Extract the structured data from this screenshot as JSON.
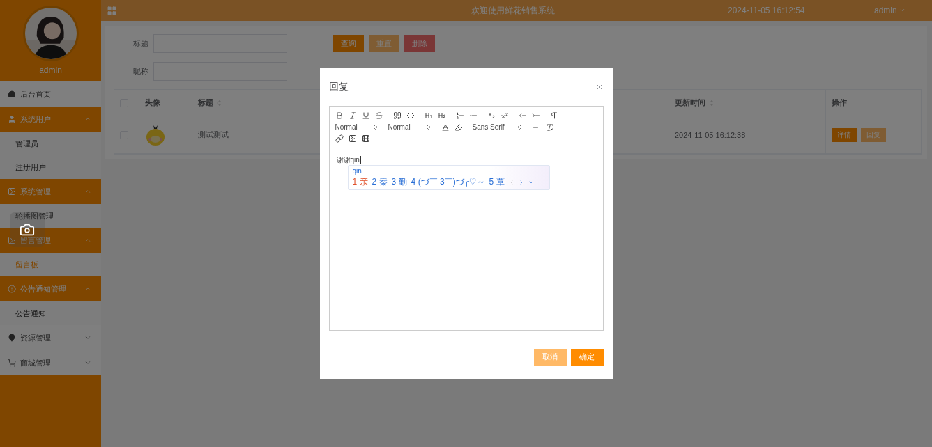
{
  "sidebar": {
    "user": "admin",
    "menu": [
      {
        "label": "后台首页",
        "kind": "link"
      },
      {
        "label": "系统用户",
        "kind": "group",
        "expanded": true,
        "children": [
          {
            "label": "管理员",
            "selected": false
          },
          {
            "label": "注册用户",
            "selected": false
          }
        ]
      },
      {
        "label": "系统管理",
        "kind": "group",
        "expanded": true,
        "children": [
          {
            "label": "轮播图管理",
            "selected": false
          }
        ]
      },
      {
        "label": "留言管理",
        "kind": "group",
        "expanded": true,
        "children": [
          {
            "label": "留言板",
            "selected": true
          }
        ]
      },
      {
        "label": "公告通知管理",
        "kind": "group",
        "expanded": true,
        "children": [
          {
            "label": "公告通知",
            "selected": false
          }
        ]
      },
      {
        "label": "资源管理",
        "kind": "group",
        "expanded": false
      },
      {
        "label": "商城管理",
        "kind": "group",
        "expanded": false
      }
    ]
  },
  "header": {
    "title": "欢迎使用鲜花销售系统",
    "datetime": "2024-11-05 16:12:54",
    "user": "admin"
  },
  "search": {
    "fields": [
      {
        "label": "标题"
      },
      {
        "label": "昵称"
      }
    ],
    "buttons": [
      {
        "label": "查询",
        "kind": "primary"
      },
      {
        "label": "重置",
        "kind": "secondary"
      },
      {
        "label": "删除",
        "kind": "danger"
      }
    ]
  },
  "table": {
    "all_checked": false,
    "columns": [
      {
        "label": "头像",
        "sortable": false
      },
      {
        "label": "标题",
        "sortable": true
      },
      {
        "label": "更新时间",
        "sortable": true
      },
      {
        "label": "操作",
        "sortable": false
      }
    ],
    "rows": [
      {
        "checked": false,
        "title": "测试测试",
        "updated": "2024-11-05 16:12:38",
        "actions": [
          {
            "label": "详情",
            "kind": "primary"
          },
          {
            "label": "回复",
            "kind": "secondary"
          }
        ]
      }
    ]
  },
  "modal": {
    "title": "回复",
    "toolbar": {
      "selects": [
        "Normal",
        "Normal",
        "Sans Serif"
      ]
    },
    "text": "谢谢qin",
    "ime": {
      "composition": "qin",
      "candidates": [
        {
          "index": "1",
          "text": "亲",
          "selected": true
        },
        {
          "index": "2",
          "text": "秦",
          "selected": false
        },
        {
          "index": "3",
          "text": "勤",
          "selected": false
        },
        {
          "index": "4",
          "text": "(づ￣ 3￣)づ╭♡～",
          "selected": false
        },
        {
          "index": "5",
          "text": "覃",
          "selected": false
        }
      ]
    },
    "buttons": [
      {
        "label": "取消",
        "kind": "secondary"
      },
      {
        "label": "确定",
        "kind": "primary"
      }
    ]
  }
}
